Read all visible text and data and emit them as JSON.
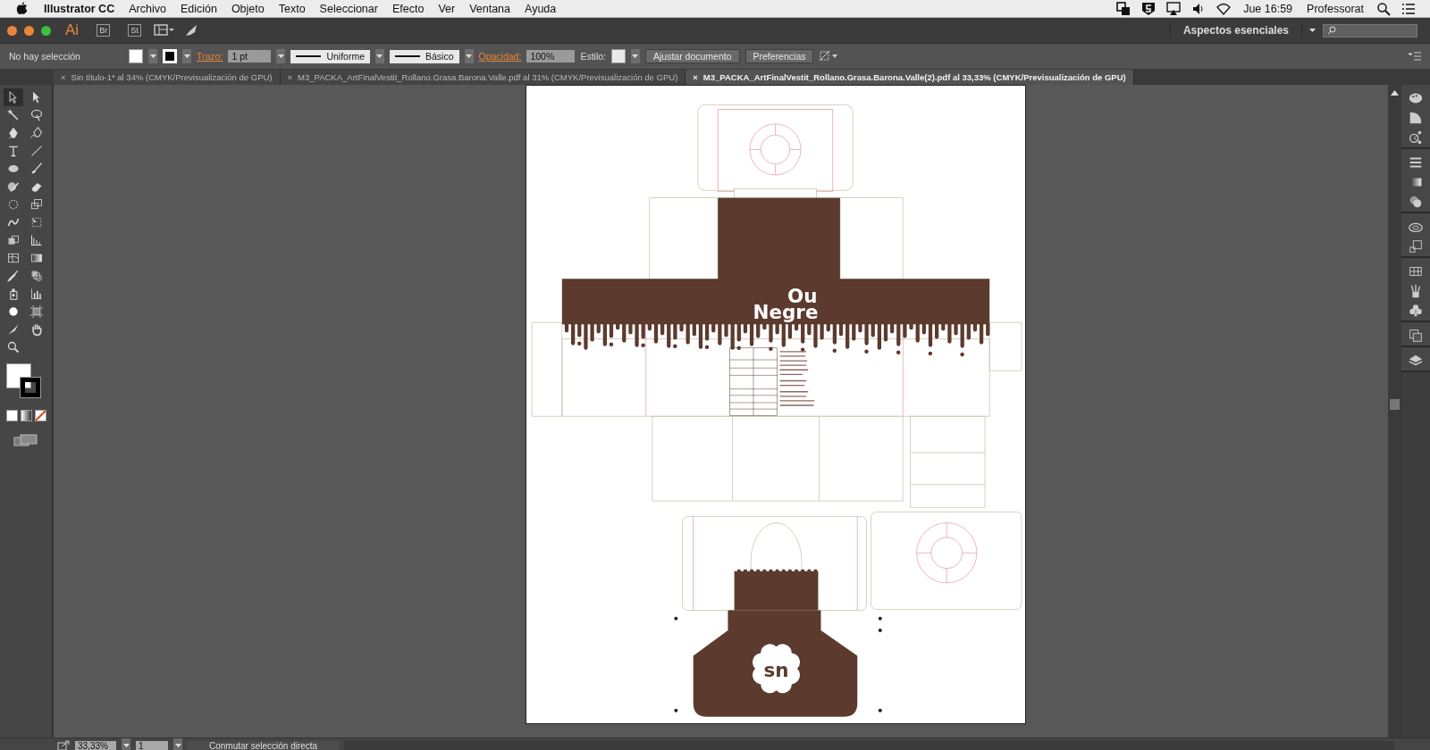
{
  "menu_bar": {
    "app": "Illustrator CC",
    "items": [
      "Archivo",
      "Edición",
      "Objeto",
      "Texto",
      "Seleccionar",
      "Efecto",
      "Ver",
      "Ventana",
      "Ayuda"
    ],
    "clock": "Jue 16:59",
    "user": "Professorat"
  },
  "app_bar": {
    "logo": "Ai",
    "bridge": "Br",
    "stock": "St",
    "workspace": "Aspectos esenciales"
  },
  "control_bar": {
    "selection": "No hay selección",
    "stroke_label": "Trazo:",
    "stroke_weight": "1 pt",
    "profile": "Uniforme",
    "brush": "Básico",
    "opacity_label": "Opacidad:",
    "opacity": "100%",
    "style_label": "Estilo:",
    "buttons": [
      "Ajustar documento",
      "Preferencias"
    ]
  },
  "tabs": [
    {
      "close": "×",
      "label": "Sin título-1* al 34% (CMYK/Previsualización de GPU)",
      "selected": false
    },
    {
      "close": "×",
      "label": "M3_PACKA_ArtFinalVestit_Rollano.Grasa.Barona.Valle.pdf al 31% (CMYK/Previsualización de GPU)",
      "selected": false
    },
    {
      "close": "×",
      "label": "M3_PACKA_ArtFinalVestit_Rollano.Grasa.Barona.Valle(2).pdf al 33,33% (CMYK/Previsualización de GPU)",
      "selected": true
    }
  ],
  "tools": [
    {
      "selected": true
    },
    {
      "selected": false
    },
    {
      "selected": false
    },
    {
      "selected": false
    },
    {
      "selected": false
    },
    {
      "selected": false
    },
    {
      "selected": false
    },
    {
      "selected": false
    },
    {
      "selected": false
    },
    {
      "selected": false
    },
    {
      "selected": false
    },
    {
      "selected": false
    },
    {
      "selected": false
    },
    {
      "selected": false
    },
    {
      "selected": false
    },
    {
      "selected": false
    },
    {
      "selected": false
    },
    {
      "selected": false
    },
    {
      "selected": false
    },
    {
      "selected": false
    },
    {
      "selected": false
    },
    {
      "selected": false
    },
    {
      "selected": false
    },
    {
      "selected": false
    },
    {
      "selected": false
    },
    {
      "selected": false
    },
    {
      "selected": false
    },
    {
      "selected": false
    },
    {
      "selected": false
    }
  ],
  "artwork": {
    "title_lines": [
      "Ou",
      "Negre"
    ],
    "logo": "sn"
  },
  "status_bar": {
    "zoom": "33,33%",
    "page": "1",
    "message": "Conmutar selección directa"
  }
}
